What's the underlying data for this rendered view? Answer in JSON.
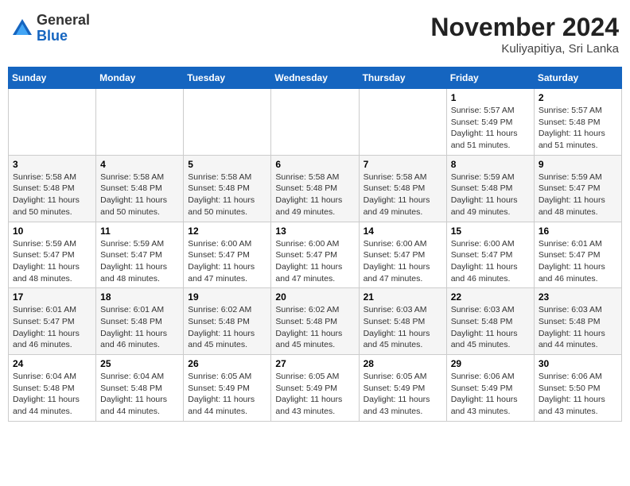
{
  "header": {
    "logo_general": "General",
    "logo_blue": "Blue",
    "month_title": "November 2024",
    "location": "Kuliyapitiya, Sri Lanka"
  },
  "days_of_week": [
    "Sunday",
    "Monday",
    "Tuesday",
    "Wednesday",
    "Thursday",
    "Friday",
    "Saturday"
  ],
  "weeks": [
    [
      {
        "day": "",
        "info": ""
      },
      {
        "day": "",
        "info": ""
      },
      {
        "day": "",
        "info": ""
      },
      {
        "day": "",
        "info": ""
      },
      {
        "day": "",
        "info": ""
      },
      {
        "day": "1",
        "info": "Sunrise: 5:57 AM\nSunset: 5:49 PM\nDaylight: 11 hours and 51 minutes."
      },
      {
        "day": "2",
        "info": "Sunrise: 5:57 AM\nSunset: 5:48 PM\nDaylight: 11 hours and 51 minutes."
      }
    ],
    [
      {
        "day": "3",
        "info": "Sunrise: 5:58 AM\nSunset: 5:48 PM\nDaylight: 11 hours and 50 minutes."
      },
      {
        "day": "4",
        "info": "Sunrise: 5:58 AM\nSunset: 5:48 PM\nDaylight: 11 hours and 50 minutes."
      },
      {
        "day": "5",
        "info": "Sunrise: 5:58 AM\nSunset: 5:48 PM\nDaylight: 11 hours and 50 minutes."
      },
      {
        "day": "6",
        "info": "Sunrise: 5:58 AM\nSunset: 5:48 PM\nDaylight: 11 hours and 49 minutes."
      },
      {
        "day": "7",
        "info": "Sunrise: 5:58 AM\nSunset: 5:48 PM\nDaylight: 11 hours and 49 minutes."
      },
      {
        "day": "8",
        "info": "Sunrise: 5:59 AM\nSunset: 5:48 PM\nDaylight: 11 hours and 49 minutes."
      },
      {
        "day": "9",
        "info": "Sunrise: 5:59 AM\nSunset: 5:47 PM\nDaylight: 11 hours and 48 minutes."
      }
    ],
    [
      {
        "day": "10",
        "info": "Sunrise: 5:59 AM\nSunset: 5:47 PM\nDaylight: 11 hours and 48 minutes."
      },
      {
        "day": "11",
        "info": "Sunrise: 5:59 AM\nSunset: 5:47 PM\nDaylight: 11 hours and 48 minutes."
      },
      {
        "day": "12",
        "info": "Sunrise: 6:00 AM\nSunset: 5:47 PM\nDaylight: 11 hours and 47 minutes."
      },
      {
        "day": "13",
        "info": "Sunrise: 6:00 AM\nSunset: 5:47 PM\nDaylight: 11 hours and 47 minutes."
      },
      {
        "day": "14",
        "info": "Sunrise: 6:00 AM\nSunset: 5:47 PM\nDaylight: 11 hours and 47 minutes."
      },
      {
        "day": "15",
        "info": "Sunrise: 6:00 AM\nSunset: 5:47 PM\nDaylight: 11 hours and 46 minutes."
      },
      {
        "day": "16",
        "info": "Sunrise: 6:01 AM\nSunset: 5:47 PM\nDaylight: 11 hours and 46 minutes."
      }
    ],
    [
      {
        "day": "17",
        "info": "Sunrise: 6:01 AM\nSunset: 5:47 PM\nDaylight: 11 hours and 46 minutes."
      },
      {
        "day": "18",
        "info": "Sunrise: 6:01 AM\nSunset: 5:48 PM\nDaylight: 11 hours and 46 minutes."
      },
      {
        "day": "19",
        "info": "Sunrise: 6:02 AM\nSunset: 5:48 PM\nDaylight: 11 hours and 45 minutes."
      },
      {
        "day": "20",
        "info": "Sunrise: 6:02 AM\nSunset: 5:48 PM\nDaylight: 11 hours and 45 minutes."
      },
      {
        "day": "21",
        "info": "Sunrise: 6:03 AM\nSunset: 5:48 PM\nDaylight: 11 hours and 45 minutes."
      },
      {
        "day": "22",
        "info": "Sunrise: 6:03 AM\nSunset: 5:48 PM\nDaylight: 11 hours and 45 minutes."
      },
      {
        "day": "23",
        "info": "Sunrise: 6:03 AM\nSunset: 5:48 PM\nDaylight: 11 hours and 44 minutes."
      }
    ],
    [
      {
        "day": "24",
        "info": "Sunrise: 6:04 AM\nSunset: 5:48 PM\nDaylight: 11 hours and 44 minutes."
      },
      {
        "day": "25",
        "info": "Sunrise: 6:04 AM\nSunset: 5:48 PM\nDaylight: 11 hours and 44 minutes."
      },
      {
        "day": "26",
        "info": "Sunrise: 6:05 AM\nSunset: 5:49 PM\nDaylight: 11 hours and 44 minutes."
      },
      {
        "day": "27",
        "info": "Sunrise: 6:05 AM\nSunset: 5:49 PM\nDaylight: 11 hours and 43 minutes."
      },
      {
        "day": "28",
        "info": "Sunrise: 6:05 AM\nSunset: 5:49 PM\nDaylight: 11 hours and 43 minutes."
      },
      {
        "day": "29",
        "info": "Sunrise: 6:06 AM\nSunset: 5:49 PM\nDaylight: 11 hours and 43 minutes."
      },
      {
        "day": "30",
        "info": "Sunrise: 6:06 AM\nSunset: 5:50 PM\nDaylight: 11 hours and 43 minutes."
      }
    ]
  ]
}
